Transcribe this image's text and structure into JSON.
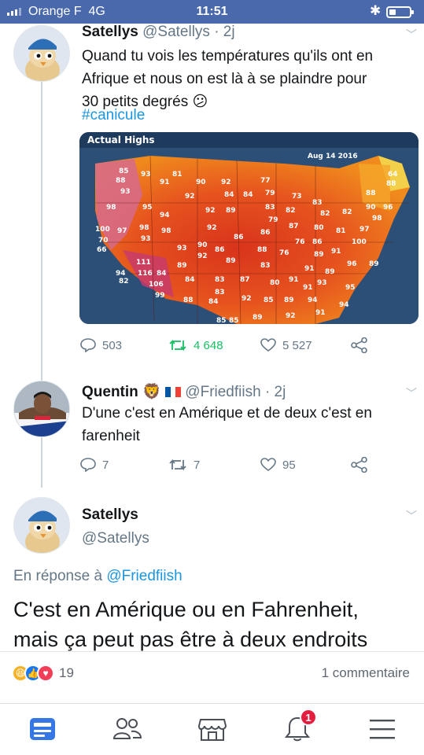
{
  "status_bar": {
    "carrier": "Orange F",
    "network": "4G",
    "time": "11:51",
    "battery_level": 0.25
  },
  "tweet1": {
    "name": "Satellys",
    "handle": "@Satellys · 2j",
    "text_lines": [
      "Quand tu vois les températures qu'ils ont en",
      "Afrique et nous on est là à se plaindre pour",
      "30 petits degrés 😕"
    ],
    "hashtag": "#canicule",
    "map": {
      "title": "Actual Highs",
      "date": "Aug 14 2016"
    },
    "replies": "503",
    "retweets": "4 648",
    "likes": "5 527"
  },
  "tweet2": {
    "name": "Quentin",
    "emoji": "🦁",
    "handle": "@Friedfiish · 2j",
    "text_lines": [
      "D'une c'est en Amérique et de deux c'est en",
      "farenheit"
    ],
    "replies": "7",
    "retweets": "7",
    "likes": "95"
  },
  "tweet3": {
    "name": "Satellys",
    "handle": "@Satellys",
    "reply_prefix": "En réponse à",
    "reply_handle": "@Friedfiish",
    "text_lines": [
      "C'est en Amérique ou en Fahrenheit,",
      "mais ça peut pas être à deux endroits"
    ]
  },
  "fb_post": {
    "reaction_count": "19",
    "comments": "1 commentaire"
  },
  "nav": {
    "notification_badge": "1"
  },
  "colors": {
    "fb_blue": "#4a69ad",
    "twitter_blue": "#1b95e0",
    "retweet_green": "#17bf63"
  }
}
